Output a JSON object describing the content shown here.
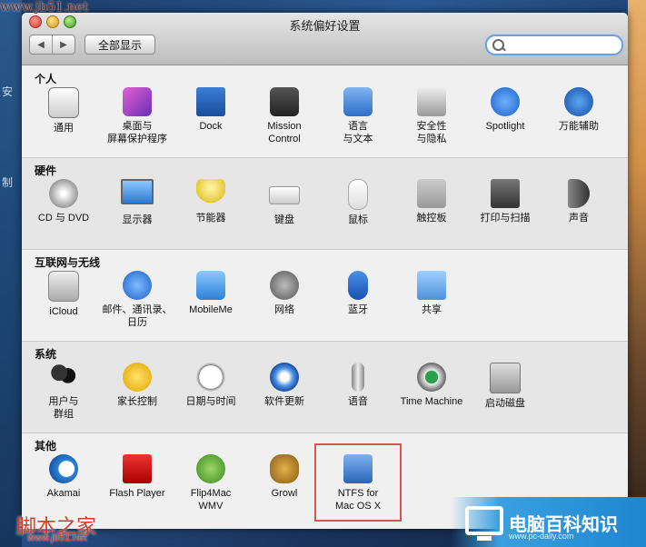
{
  "window": {
    "title": "系统偏好设置"
  },
  "toolbar": {
    "back": "◀",
    "forward": "▶",
    "show_all": "全部显示",
    "search_value": ""
  },
  "sections": [
    {
      "title": "个人",
      "items": [
        "通用",
        "桌面与\n屏幕保护程序",
        "Dock",
        "Mission\nControl",
        "语言\n与文本",
        "安全性\n与隐私",
        "Spotlight",
        "万能辅助"
      ]
    },
    {
      "title": "硬件",
      "items": [
        "CD 与 DVD",
        "显示器",
        "节能器",
        "键盘",
        "鼠标",
        "触控板",
        "打印与扫描",
        "声音"
      ]
    },
    {
      "title": "互联网与无线",
      "items": [
        "iCloud",
        "邮件、通讯录、\n日历",
        "MobileMe",
        "网络",
        "蓝牙",
        "共享"
      ]
    },
    {
      "title": "系统",
      "items": [
        "用户与\n群组",
        "家长控制",
        "日期与时间",
        "软件更新",
        "语音",
        "Time Machine",
        "启动磁盘"
      ]
    },
    {
      "title": "其他",
      "items": [
        "Akamai",
        "Flash Player",
        "Flip4Mac\nWMV",
        "Growl",
        "NTFS for\nMac OS X"
      ]
    }
  ],
  "watermarks": {
    "top": "www.jb51.net",
    "bottom_left_big": "脚本之家",
    "bottom_left_small": "www.jb51.net",
    "bottom_right": "电脑百科知识",
    "bottom_right_small": "www.pc-daily.com"
  },
  "desktop_left": {
    "a": "安",
    "b": "制"
  },
  "icon_colors": {
    "accent": "#3b7fd6",
    "highlight": "#d9534f"
  }
}
